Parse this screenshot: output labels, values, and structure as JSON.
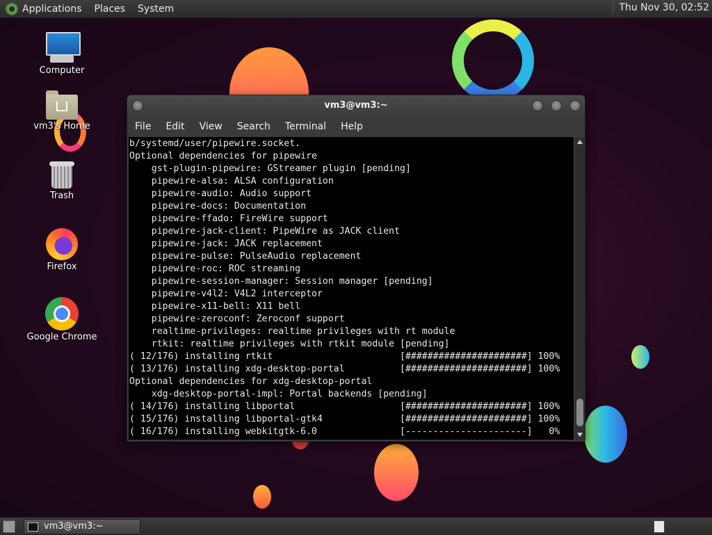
{
  "top_panel": {
    "menus": [
      "Applications",
      "Places",
      "System"
    ],
    "clock": "Thu Nov 30, 02:52"
  },
  "desktop": {
    "icons": [
      {
        "label": "Computer",
        "icon": "computer-icon"
      },
      {
        "label": "vm3's Home",
        "icon": "home-folder-icon"
      },
      {
        "label": "Trash",
        "icon": "trash-icon"
      },
      {
        "label": "Firefox",
        "icon": "firefox-icon"
      },
      {
        "label": "Google Chrome",
        "icon": "chrome-icon"
      }
    ]
  },
  "terminal": {
    "title": "vm3@vm3:~",
    "menu": [
      "File",
      "Edit",
      "View",
      "Search",
      "Terminal",
      "Help"
    ],
    "lines": [
      "b/systemd/user/pipewire.socket.",
      "Optional dependencies for pipewire",
      "    gst-plugin-pipewire: GStreamer plugin [pending]",
      "    pipewire-alsa: ALSA configuration",
      "    pipewire-audio: Audio support",
      "    pipewire-docs: Documentation",
      "    pipewire-ffado: FireWire support",
      "    pipewire-jack-client: PipeWire as JACK client",
      "    pipewire-jack: JACK replacement",
      "    pipewire-pulse: PulseAudio replacement",
      "    pipewire-roc: ROC streaming",
      "    pipewire-session-manager: Session manager [pending]",
      "    pipewire-v4l2: V4L2 interceptor",
      "    pipewire-x11-bell: X11 bell",
      "    pipewire-zeroconf: Zeroconf support",
      "    realtime-privileges: realtime privileges with rt module",
      "    rtkit: realtime privileges with rtkit module [pending]",
      "( 12/176) installing rtkit                       [######################] 100%",
      "( 13/176) installing xdg-desktop-portal          [######################] 100%",
      "Optional dependencies for xdg-desktop-portal",
      "    xdg-desktop-portal-impl: Portal backends [pending]",
      "( 14/176) installing libportal                   [######################] 100%",
      "( 15/176) installing libportal-gtk4              [######################] 100%",
      "( 16/176) installing webkitgtk-6.0               [----------------------]   0%"
    ]
  },
  "taskbar": {
    "window_button": "vm3@vm3:~"
  }
}
